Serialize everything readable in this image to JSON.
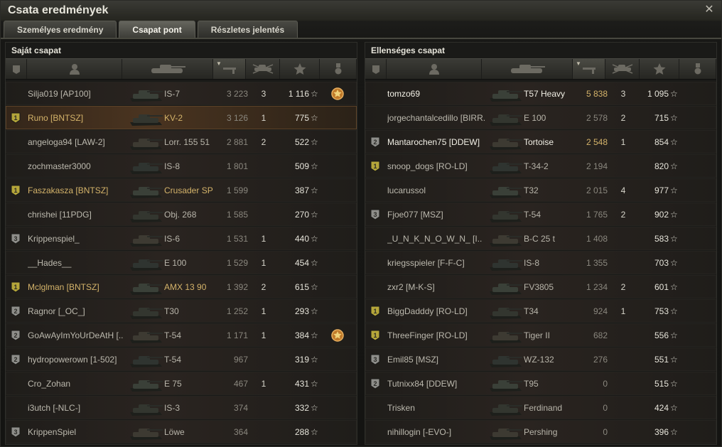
{
  "window": {
    "title": "Csata eredmények",
    "close_label": "✕"
  },
  "tabs": [
    {
      "label": "Személyes eredmény",
      "active": false
    },
    {
      "label": "Csapat pont",
      "active": true
    },
    {
      "label": "Részletes jelentés",
      "active": false
    }
  ],
  "star_glyph": "☆",
  "sort_glyph": "▼",
  "teams": [
    {
      "title": "Saját csapat",
      "players": [
        {
          "name": "Silja019 [AP100]",
          "tank": "IS-7",
          "damage": "3 223",
          "kills": "3",
          "xp": "1 116",
          "badge": "",
          "medal": true,
          "style": "normal"
        },
        {
          "name": "Runo [BNTSZ]",
          "tank": "KV-2",
          "damage": "3 126",
          "kills": "1",
          "xp": "775",
          "badge": "1",
          "medal": false,
          "style": "self"
        },
        {
          "name": "angeloga94 [LAW-2]",
          "tank": "Lorr. 155 51",
          "damage": "2 881",
          "kills": "2",
          "xp": "522",
          "badge": "",
          "medal": false,
          "style": "normal"
        },
        {
          "name": "zochmaster3000",
          "tank": "IS-8",
          "damage": "1 801",
          "kills": "",
          "xp": "509",
          "badge": "",
          "medal": false,
          "style": "normal"
        },
        {
          "name": "Faszakasza [BNTSZ]",
          "tank": "Crusader SP",
          "damage": "1 599",
          "kills": "",
          "xp": "387",
          "badge": "1",
          "medal": false,
          "style": "platoon"
        },
        {
          "name": "chrishei [11PDG]",
          "tank": "Obj. 268",
          "damage": "1 585",
          "kills": "",
          "xp": "270",
          "badge": "",
          "medal": false,
          "style": "normal"
        },
        {
          "name": "Krippenspiel_",
          "tank": "IS-6",
          "damage": "1 531",
          "kills": "1",
          "xp": "440",
          "badge": "3",
          "medal": false,
          "style": "normal"
        },
        {
          "name": "__Hades__",
          "tank": "E 100",
          "damage": "1 529",
          "kills": "1",
          "xp": "454",
          "badge": "",
          "medal": false,
          "style": "normal"
        },
        {
          "name": "Mclglman [BNTSZ]",
          "tank": "AMX 13 90",
          "damage": "1 392",
          "kills": "2",
          "xp": "615",
          "badge": "1",
          "medal": false,
          "style": "platoon"
        },
        {
          "name": "Ragnor [_OC_]",
          "tank": "T30",
          "damage": "1 252",
          "kills": "1",
          "xp": "293",
          "badge": "2",
          "medal": false,
          "style": "normal"
        },
        {
          "name": "GoAwAyImYoUrDeAtH [..",
          "tank": "T-54",
          "damage": "1 171",
          "kills": "1",
          "xp": "384",
          "badge": "2",
          "medal": true,
          "style": "normal"
        },
        {
          "name": "hydropowerown [1-502]",
          "tank": "T-54",
          "damage": "967",
          "kills": "",
          "xp": "319",
          "badge": "2",
          "medal": false,
          "style": "normal"
        },
        {
          "name": "Cro_Zohan",
          "tank": "E 75",
          "damage": "467",
          "kills": "1",
          "xp": "431",
          "badge": "",
          "medal": false,
          "style": "normal"
        },
        {
          "name": "i3utch [-NLC-]",
          "tank": "IS-3",
          "damage": "374",
          "kills": "",
          "xp": "332",
          "badge": "",
          "medal": false,
          "style": "normal"
        },
        {
          "name": "KrippenSpiel",
          "tank": "Löwe",
          "damage": "364",
          "kills": "",
          "xp": "288",
          "badge": "3",
          "medal": false,
          "style": "normal"
        }
      ]
    },
    {
      "title": "Ellenséges csapat",
      "players": [
        {
          "name": "tomzo69",
          "tank": "T57 Heavy",
          "damage": "5 838",
          "kills": "3",
          "xp": "1 095",
          "badge": "",
          "medal": false,
          "style": "top"
        },
        {
          "name": "jorgechantalcedillo [BIRR.",
          "tank": "E 100",
          "damage": "2 578",
          "kills": "2",
          "xp": "715",
          "badge": "",
          "medal": false,
          "style": "normal"
        },
        {
          "name": "Mantarochen75 [DDEW]",
          "tank": "Tortoise",
          "damage": "2 548",
          "kills": "1",
          "xp": "854",
          "badge": "2",
          "medal": false,
          "style": "top"
        },
        {
          "name": "snoop_dogs [RO-LD]",
          "tank": "T-34-2",
          "damage": "2 194",
          "kills": "",
          "xp": "820",
          "badge": "1",
          "medal": false,
          "style": "normal"
        },
        {
          "name": "lucarussol",
          "tank": "T32",
          "damage": "2 015",
          "kills": "4",
          "xp": "977",
          "badge": "",
          "medal": false,
          "style": "normal"
        },
        {
          "name": "Fjoe077 [MSZ]",
          "tank": "T-54",
          "damage": "1 765",
          "kills": "2",
          "xp": "902",
          "badge": "3",
          "medal": false,
          "style": "normal"
        },
        {
          "name": "_U_N_K_N_O_W_N_ [I..",
          "tank": "B-C 25 t",
          "damage": "1 408",
          "kills": "",
          "xp": "583",
          "badge": "",
          "medal": false,
          "style": "normal"
        },
        {
          "name": "kriegsspieler [F-F-C]",
          "tank": "IS-8",
          "damage": "1 355",
          "kills": "",
          "xp": "703",
          "badge": "",
          "medal": false,
          "style": "normal"
        },
        {
          "name": "zxr2 [M-K-S]",
          "tank": "FV3805",
          "damage": "1 234",
          "kills": "2",
          "xp": "601",
          "badge": "",
          "medal": false,
          "style": "normal"
        },
        {
          "name": "BiggDadddy [RO-LD]",
          "tank": "T34",
          "damage": "924",
          "kills": "1",
          "xp": "753",
          "badge": "1",
          "medal": false,
          "style": "normal"
        },
        {
          "name": "ThreeFinger [RO-LD]",
          "tank": "Tiger II",
          "damage": "682",
          "kills": "",
          "xp": "556",
          "badge": "1",
          "medal": false,
          "style": "normal"
        },
        {
          "name": "Emil85 [MSZ]",
          "tank": "WZ-132",
          "damage": "276",
          "kills": "",
          "xp": "551",
          "badge": "3",
          "medal": false,
          "style": "normal"
        },
        {
          "name": "Tutnixx84 [DDEW]",
          "tank": "T95",
          "damage": "0",
          "kills": "",
          "xp": "515",
          "badge": "2",
          "medal": false,
          "style": "normal"
        },
        {
          "name": "Trisken",
          "tank": "Ferdinand",
          "damage": "0",
          "kills": "",
          "xp": "424",
          "badge": "",
          "medal": false,
          "style": "normal"
        },
        {
          "name": "nihillogin [-EVO-]",
          "tank": "Pershing",
          "damage": "0",
          "kills": "",
          "xp": "396",
          "badge": "",
          "medal": false,
          "style": "normal"
        }
      ]
    }
  ]
}
